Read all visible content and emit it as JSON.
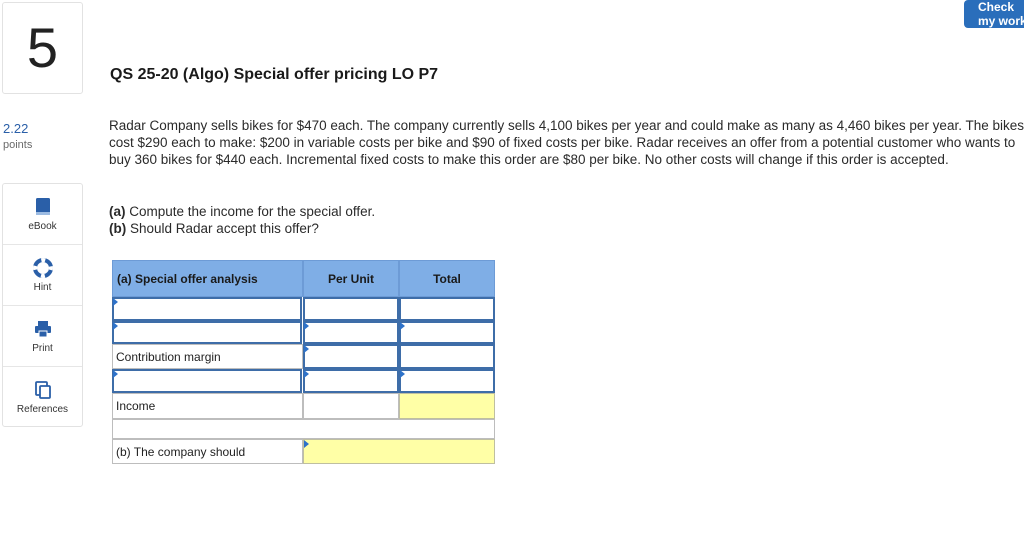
{
  "question": {
    "number": "5",
    "points_value": "2.22",
    "points_label": "points",
    "title": "QS 25-20 (Algo) Special offer pricing LO P7"
  },
  "toolbar": {
    "check_label": "Check my work"
  },
  "tools": [
    {
      "label": "eBook",
      "icon": "book-icon"
    },
    {
      "label": "Hint",
      "icon": "lifebuoy-icon"
    },
    {
      "label": "Print",
      "icon": "printer-icon"
    },
    {
      "label": "References",
      "icon": "references-icon"
    }
  ],
  "problem_text": "Radar Company sells bikes for $470 each. The company currently sells 4,100 bikes per year and could make as many as 4,460 bikes per year. The bikes cost $290 each to make: $200 in variable costs per bike and $90 of fixed costs per bike. Radar receives an offer from a potential customer who wants to buy 360 bikes for $440 each. Incremental fixed costs to make this order are $80 per bike. No other costs will change if this order is accepted.",
  "requirements": {
    "a_prefix": "(a)",
    "a_text": " Compute the income for the special offer.",
    "b_prefix": "(b)",
    "b_text": " Should Radar accept this offer?"
  },
  "table": {
    "headers": [
      "(a) Special offer analysis",
      "Per Unit",
      "Total"
    ],
    "rows": [
      {
        "label": "",
        "per_unit": "",
        "total": ""
      },
      {
        "label": "",
        "per_unit": "",
        "total": ""
      },
      {
        "label": "Contribution margin",
        "per_unit": "",
        "total": ""
      },
      {
        "label": "",
        "per_unit": "",
        "total": ""
      },
      {
        "label": "Income",
        "per_unit": "",
        "total": ""
      }
    ],
    "b_label": "(b) The company should",
    "b_answer": ""
  },
  "colors": {
    "accent": "#2a6ebb",
    "header_bg": "#7faee6",
    "answer_bg": "#ffffa6"
  }
}
